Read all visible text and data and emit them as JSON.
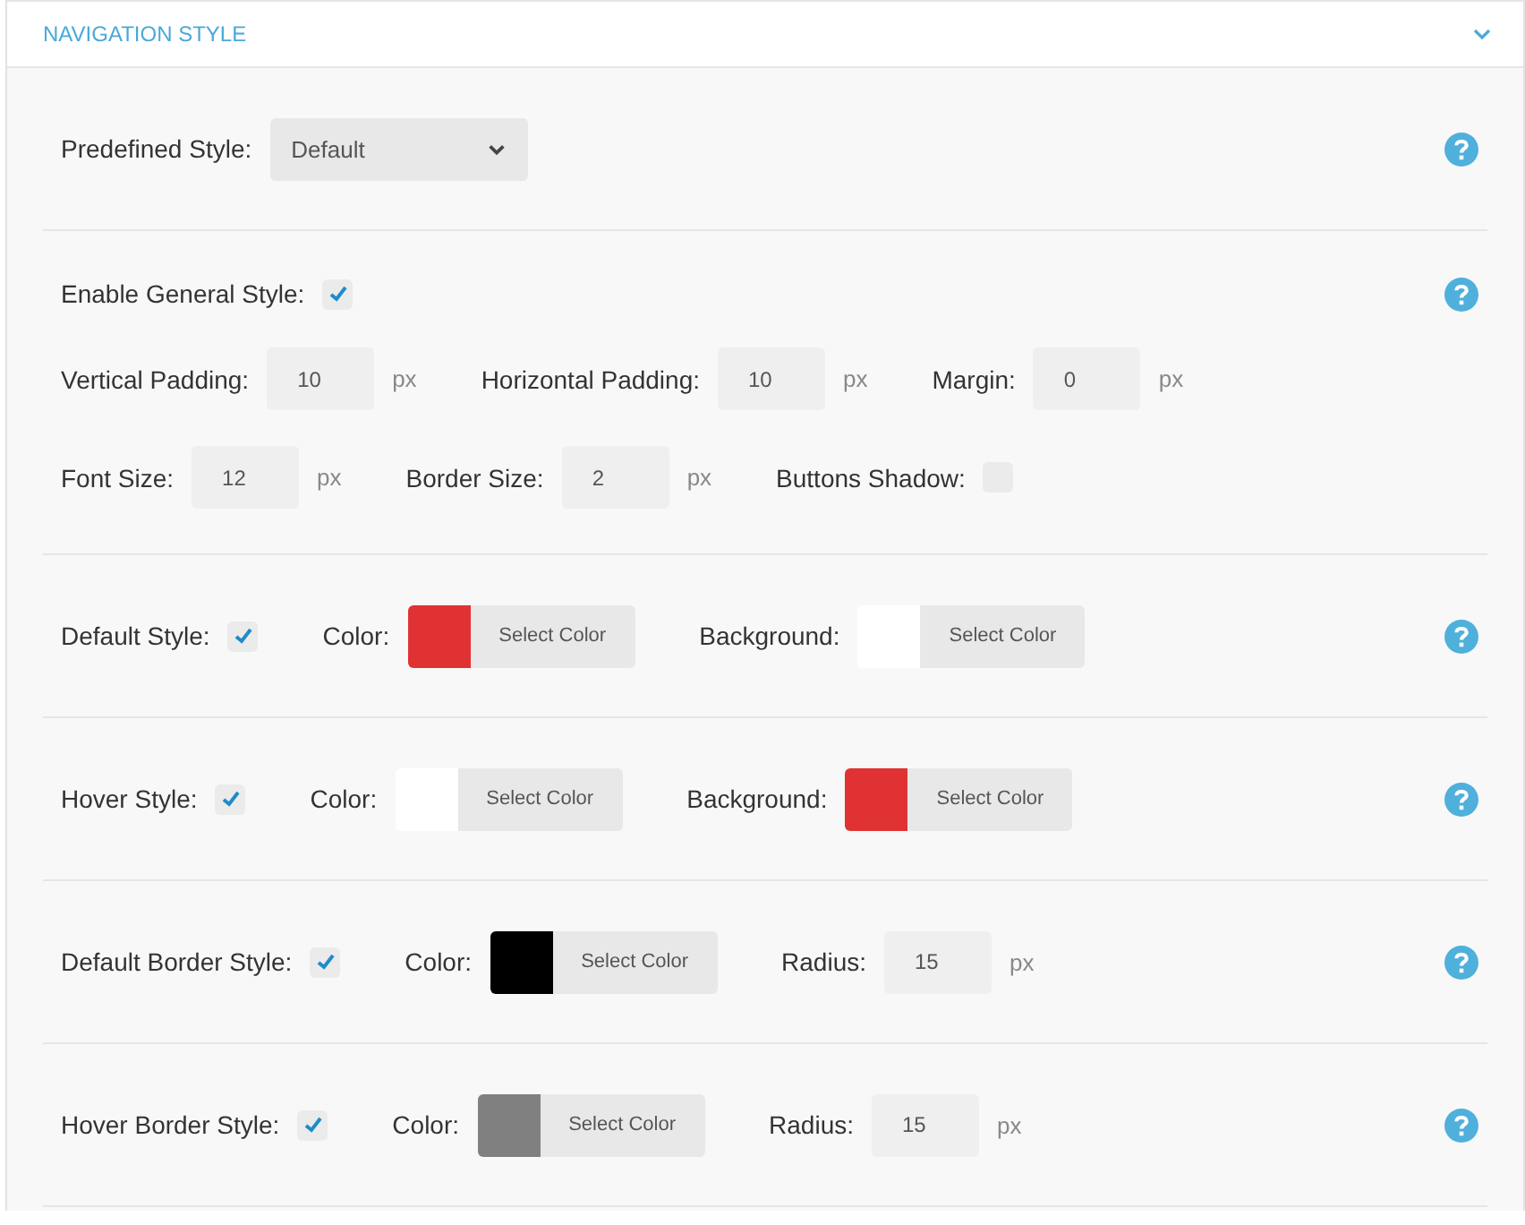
{
  "panel": {
    "title": "NAVIGATION STYLE",
    "expanded": true
  },
  "sections": [
    {
      "help": true,
      "rows": [
        [
          {
            "kind": "select",
            "label": "Predefined Style:",
            "value": "Default"
          }
        ]
      ]
    },
    {
      "help": true,
      "rows": [
        [
          {
            "kind": "checkbox",
            "label": "Enable General Style:",
            "checked": true
          }
        ],
        [
          {
            "kind": "number",
            "label": "Vertical Padding:",
            "value": "10",
            "unit": "px"
          },
          {
            "kind": "number",
            "label": "Horizontal Padding:",
            "value": "10",
            "unit": "px"
          },
          {
            "kind": "number",
            "label": "Margin:",
            "value": "0",
            "unit": "px"
          }
        ],
        [
          {
            "kind": "number",
            "label": "Font Size:",
            "value": "12",
            "unit": "px"
          },
          {
            "kind": "number",
            "label": "Border Size:",
            "value": "2",
            "unit": "px"
          },
          {
            "kind": "checkbox",
            "label": "Buttons Shadow:",
            "checked": false
          }
        ]
      ]
    },
    {
      "help": true,
      "rows": [
        [
          {
            "kind": "checkbox",
            "label": "Default Style:",
            "checked": true
          },
          {
            "kind": "color",
            "label": "Color:",
            "color": "#e03232",
            "button": "Select Color"
          },
          {
            "kind": "color",
            "label": "Background:",
            "color": "#ffffff",
            "button": "Select Color"
          }
        ]
      ]
    },
    {
      "help": true,
      "rows": [
        [
          {
            "kind": "checkbox",
            "label": "Hover Style:",
            "checked": true
          },
          {
            "kind": "color",
            "label": "Color:",
            "color": "#ffffff",
            "button": "Select Color"
          },
          {
            "kind": "color",
            "label": "Background:",
            "color": "#e03232",
            "button": "Select Color"
          }
        ]
      ]
    },
    {
      "help": true,
      "rows": [
        [
          {
            "kind": "checkbox",
            "label": "Default Border Style:",
            "checked": true
          },
          {
            "kind": "color",
            "label": "Color:",
            "color": "#000000",
            "button": "Select Color"
          },
          {
            "kind": "number",
            "label": "Radius:",
            "value": "15",
            "unit": "px"
          }
        ]
      ]
    },
    {
      "help": true,
      "rows": [
        [
          {
            "kind": "checkbox",
            "label": "Hover Border Style:",
            "checked": true
          },
          {
            "kind": "color",
            "label": "Color:",
            "color": "#808080",
            "button": "Select Color"
          },
          {
            "kind": "number",
            "label": "Radius:",
            "value": "15",
            "unit": "px"
          }
        ]
      ]
    }
  ]
}
